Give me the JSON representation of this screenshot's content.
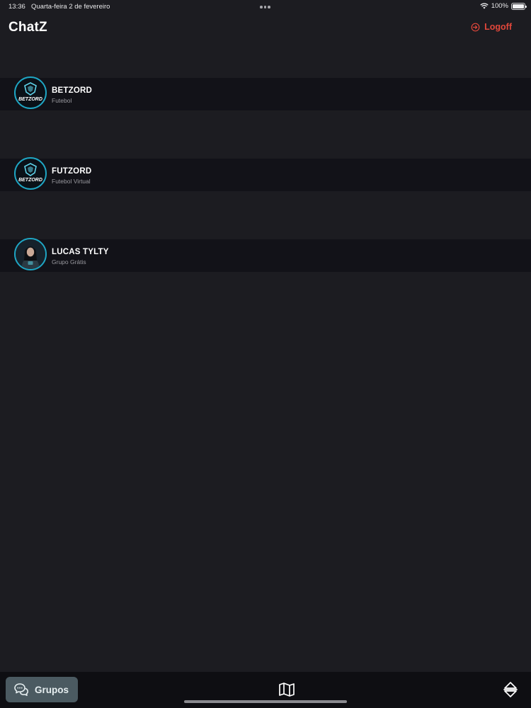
{
  "status_bar": {
    "time": "13:36",
    "date": "Quarta-feira 2 de fevereiro",
    "battery": "100%",
    "battery_level": 1.0
  },
  "header": {
    "title": "ChatZ",
    "logoff_label": "Logoff"
  },
  "groups": [
    {
      "name": "BETZORD",
      "subtitle": "Futebol",
      "avatar_text": "BETZORD",
      "avatar": "betzord-logo-icon"
    },
    {
      "name": "FUTZORD",
      "subtitle": "Futebol Virtual",
      "avatar_text": "BETZORD",
      "avatar": "betzord-logo-icon"
    },
    {
      "name": "LUCAS TYLTY",
      "subtitle": "Grupo Grátis",
      "avatar": "person-photo-avatar"
    }
  ],
  "bottom_bar": {
    "grupos_label": "Grupos",
    "grupos_icon": "chat-bubbles-icon",
    "map_icon": "map-icon",
    "sort_icon": "sort-icon"
  },
  "colors": {
    "background": "#1c1c21",
    "row_background": "#121218",
    "accent_red": "#e2473b",
    "avatar_ring": "#1fa6c4",
    "tab_active": "#4b5a61"
  }
}
